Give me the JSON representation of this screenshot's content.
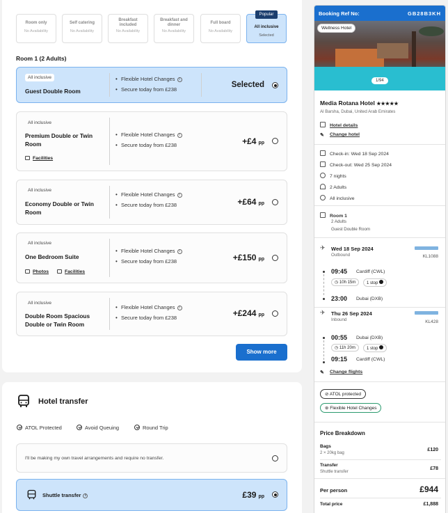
{
  "boards": [
    {
      "name": "Room only",
      "availability": "No Availability"
    },
    {
      "name": "Self catering",
      "availability": "No Availability"
    },
    {
      "name": "Breakfast included",
      "availability": "No Availability"
    },
    {
      "name": "Breakfast and dinner",
      "availability": "No Availability"
    },
    {
      "name": "Full board",
      "availability": "No Availability"
    },
    {
      "name": "All inclusive",
      "availability": "Selected",
      "badge": "Popular"
    }
  ],
  "room_heading": "Room 1 (2 Adults)",
  "features": {
    "flexible": "Flexible Hotel Changes",
    "secure": "Secure today from £238"
  },
  "rooms": [
    {
      "board": "All inclusive",
      "name": "Guest Double Room",
      "price": "Selected",
      "pp": ""
    },
    {
      "board": "All inclusive",
      "name": "Premium Double or Twin Room",
      "price": "+£4",
      "pp": "pp",
      "facilities": "Facilities"
    },
    {
      "board": "All inclusive",
      "name": "Economy Double or Twin Room",
      "price": "+£64",
      "pp": "pp"
    },
    {
      "board": "All inclusive",
      "name": "One Bedroom Suite",
      "price": "+£150",
      "pp": "pp",
      "photos": "Photos",
      "facilities": "Facilities"
    },
    {
      "board": "All inclusive",
      "name": "Double Room Spacious Double or Twin Room",
      "price": "+£244",
      "pp": "pp"
    }
  ],
  "show_more": "Show more",
  "transfer": {
    "title": "Hotel transfer",
    "features": [
      "ATOL Protected",
      "Avoid Queuing",
      "Round Trip"
    ],
    "no_transfer": "I'll be making my own travel arrangements and require no transfer.",
    "shuttle_label": "Shuttle transfer",
    "shuttle_price": "£39",
    "shuttle_pp": "pp"
  },
  "summary": {
    "booking_ref_label": "Booking Ref No:",
    "booking_ref": "GB28B3KH",
    "photo_tag": "Wellness Hotel",
    "photo_count": "1/94",
    "hotel_name": "Media Rotana Hotel",
    "stars": "★★★★★",
    "location": "Al Barsha, Dubai, United Arab Emirates",
    "hotel_details": "Hotel details",
    "change_hotel": "Change hotel",
    "checkin": "Check-in: Wed 18 Sep 2024",
    "checkout": "Check-out: Wed 25 Sep 2024",
    "nights": "7 nights",
    "adults": "2 Adults",
    "board": "All inclusive",
    "room_title": "Room 1",
    "room_adults": "2 Adults",
    "room_type": "Guest Double Room",
    "outbound": {
      "date": "Wed 18 Sep 2024",
      "dir": "Outbound",
      "flight": "KL1088",
      "dep_time": "09:45",
      "dep_port": "Cardiff (CWL)",
      "duration": "10h 15m",
      "stops": "1 stop",
      "arr_time": "23:00",
      "arr_port": "Dubai (DXB)"
    },
    "inbound": {
      "date": "Thu 26 Sep 2024",
      "dir": "Inbound",
      "flight": "KL428",
      "dep_time": "00:55",
      "dep_port": "Dubai (DXB)",
      "duration": "11h 20m",
      "stops": "1 stop",
      "arr_time": "09:15",
      "arr_port": "Cardiff (CWL)"
    },
    "change_flights": "Change flights",
    "atol": "ATOL protected",
    "flex": "Flexible Hotel Changes",
    "price_breakdown": "Price Breakdown",
    "bags_label": "Bags",
    "bags_sub": "2 × 20kg bag",
    "bags_price": "£120",
    "transfer_label": "Transfer",
    "transfer_sub": "Shuttle transfer",
    "transfer_price": "£78",
    "per_person_label": "Per person",
    "per_person": "£944",
    "total_label": "Total price",
    "total": "£1,888"
  }
}
